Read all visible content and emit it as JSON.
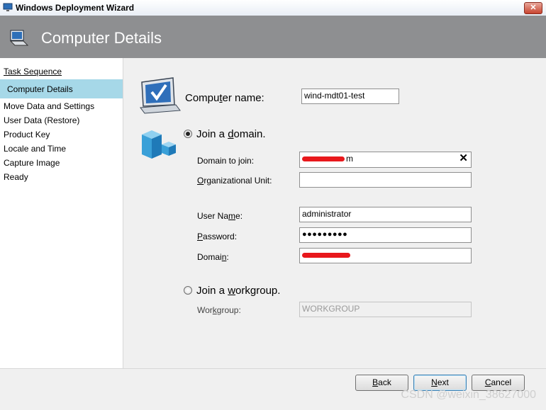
{
  "window": {
    "title": "Windows Deployment Wizard",
    "close_glyph": "✕"
  },
  "banner": {
    "title": "Computer Details",
    "icon": "computer-icon"
  },
  "sidebar": {
    "items": [
      {
        "label": "Task Sequence"
      },
      {
        "label": "Computer Details",
        "active": true
      },
      {
        "label": "Move Data and Settings"
      },
      {
        "label": "User Data (Restore)"
      },
      {
        "label": "Product Key"
      },
      {
        "label": "Locale and Time"
      },
      {
        "label": "Capture Image"
      },
      {
        "label": "Ready"
      }
    ]
  },
  "form": {
    "computer_name": {
      "label_pre": "Compu",
      "label_key": "t",
      "label_post": "er name:",
      "value": "wind-mdt01-test"
    },
    "join_domain": {
      "label_pre": "Join a ",
      "label_key": "d",
      "label_post": "omain.",
      "selected": true
    },
    "domain_to_join": {
      "label": "Domain to join:",
      "value_suffix": "m",
      "redacted": true,
      "clear_glyph": "✕"
    },
    "org_unit": {
      "label_pre": "",
      "label_key": "O",
      "label_post": "rganizational Unit:",
      "value": ""
    },
    "user_name": {
      "label_pre": "User Na",
      "label_key": "m",
      "label_post": "e:",
      "value": "administrator"
    },
    "password": {
      "label_pre": "",
      "label_key": "P",
      "label_post": "assword:",
      "value": "●●●●●●●●●"
    },
    "domain": {
      "label_pre": "Domai",
      "label_key": "n",
      "label_post": ":",
      "redacted": true
    },
    "join_workgroup": {
      "label_pre": "Join a ",
      "label_key": "w",
      "label_post": "orkgroup.",
      "selected": false
    },
    "workgroup": {
      "label_pre": "Wor",
      "label_key": "k",
      "label_post": "group:",
      "placeholder": "WORKGROUP"
    }
  },
  "buttons": {
    "back": {
      "key": "B",
      "rest": "ack"
    },
    "next": {
      "key": "N",
      "rest": "ext"
    },
    "cancel": {
      "key": "C",
      "rest": "ancel"
    }
  },
  "watermark": "CSDN @weixin_38627000",
  "colors": {
    "banner": "#8e8f91",
    "active_nav": "#a6d8e8",
    "redaction": "#e8181c"
  }
}
